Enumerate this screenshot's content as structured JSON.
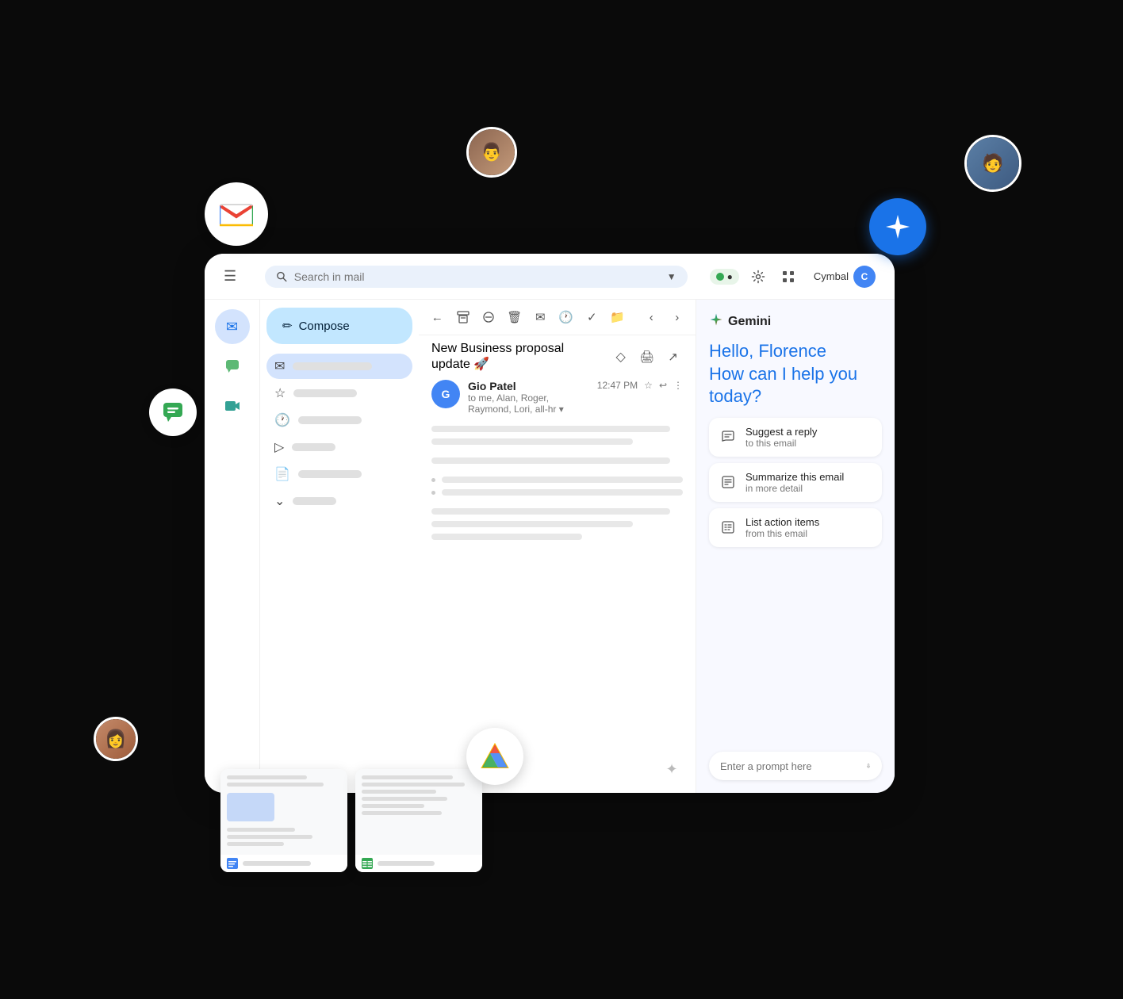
{
  "scene": {
    "gmail_logo_letter": "M",
    "gemini_star": "✦"
  },
  "topbar": {
    "search_placeholder": "Search in mail",
    "status_label": "●",
    "account_name": "Cymbal"
  },
  "compose": {
    "label": "Compose",
    "icon": "✏"
  },
  "nav_items": [
    {
      "icon": "✉",
      "active": true
    },
    {
      "icon": "★",
      "active": false
    },
    {
      "icon": "🕐",
      "active": false
    },
    {
      "icon": "⏩",
      "active": false
    },
    {
      "icon": "▷",
      "active": false
    },
    {
      "icon": "📄",
      "active": false
    },
    {
      "icon": "⌄",
      "active": false
    }
  ],
  "email": {
    "subject": "New Business proposal update 🚀",
    "sender_name": "Gio Patel",
    "sender_initials": "G",
    "to": "to me, Alan, Roger, Raymond, Lori, all-hr ▾",
    "time": "12:47 PM"
  },
  "gemini": {
    "panel_title": "Gemini",
    "greeting_prefix": "Hello,",
    "greeting_name": "Florence",
    "greeting_question": "How can I help you today?",
    "suggestions": [
      {
        "title": "Suggest a reply",
        "subtitle": "to this email",
        "icon": "✏"
      },
      {
        "title": "Summarize this email",
        "subtitle": "in more detail",
        "icon": "📋"
      },
      {
        "title": "List action items",
        "subtitle": "from this email",
        "icon": "📋"
      }
    ],
    "prompt_placeholder": "Enter a prompt here"
  },
  "drive_badge": "▲",
  "docs": [
    {
      "footer_icon": "📘",
      "color": "#4285f4"
    },
    {
      "footer_icon": "📗",
      "color": "#34a853"
    }
  ]
}
